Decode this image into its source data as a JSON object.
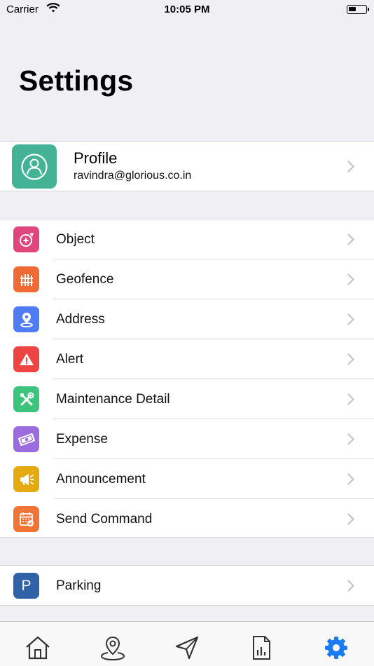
{
  "status_bar": {
    "carrier": "Carrier",
    "time": "10:05 PM"
  },
  "title": "Settings",
  "profile": {
    "name": "Profile",
    "email": "ravindra@glorious.co.in"
  },
  "menu": [
    {
      "label": "Object",
      "icon": "object-icon",
      "color": "#e0457b"
    },
    {
      "label": "Geofence",
      "icon": "fence-icon",
      "color": "#f06a35"
    },
    {
      "label": "Address",
      "icon": "location-pin-icon",
      "color": "#4f7cf4"
    },
    {
      "label": "Alert",
      "icon": "warning-icon",
      "color": "#ef4444"
    },
    {
      "label": "Maintenance Detail",
      "icon": "tools-icon",
      "color": "#3cc47c"
    },
    {
      "label": "Expense",
      "icon": "money-icon",
      "color": "#9b6cde"
    },
    {
      "label": "Announcement",
      "icon": "megaphone-icon",
      "color": "#e5a912"
    },
    {
      "label": "Send Command",
      "icon": "calendar-command-icon",
      "color": "#ef7436"
    }
  ],
  "parking": {
    "label": "Parking",
    "icon_letter": "P",
    "color": "#2f62a6"
  },
  "tab_bar": {
    "items": [
      "home-icon",
      "map-pin-icon",
      "navigation-icon",
      "report-icon",
      "settings-gear-icon"
    ],
    "active": "settings-gear-icon",
    "active_color": "#1a7cf5"
  }
}
